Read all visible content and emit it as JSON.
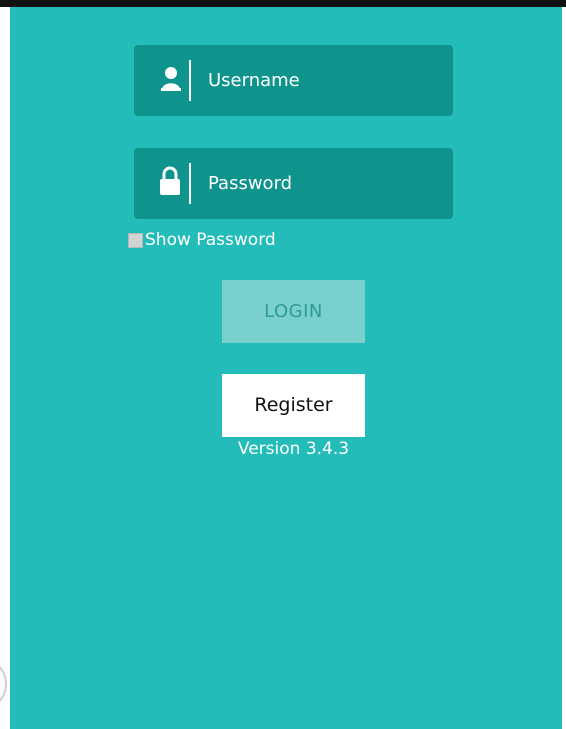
{
  "login_form": {
    "username": {
      "placeholder": "Username",
      "icon": "user-icon"
    },
    "password": {
      "placeholder": "Password",
      "icon": "lock-icon"
    },
    "show_password": {
      "label": "Show Password",
      "checked": false
    },
    "login_label": "LOGIN",
    "register_label": "Register",
    "version": "Version 3.4.3"
  },
  "colors": {
    "background": "#24bcb9",
    "field": "#0f948d",
    "login_button": "#79d0cc",
    "login_text": "#2f9b96",
    "register_button": "#ffffff"
  }
}
